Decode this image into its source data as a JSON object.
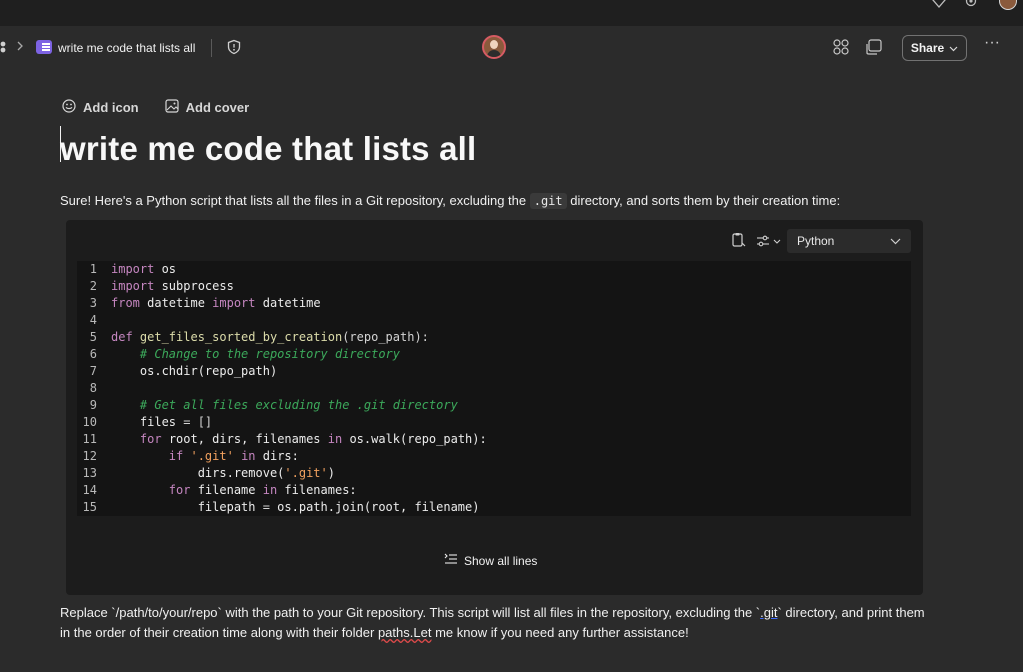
{
  "breadcrumb": {
    "page_title": "write me code that lists all"
  },
  "toolbar": {
    "share_label": "Share",
    "more_label": "···"
  },
  "page": {
    "add_icon_label": "Add icon",
    "add_cover_label": "Add cover",
    "title": "write me code that lists all",
    "intro_before": "Sure! Here's a Python script that lists all the files in a Git repository, excluding the ",
    "intro_code": ".git",
    "intro_after": " directory, and sorts them by their creation time:",
    "outro_before": "Replace `/path/to/your/repo` with the path to your Git repository. This script will list all files in the repository, excluding the `",
    "outro_u1": ".git",
    "outro_mid": "` directory, and print them in the order of their creation time along with their folder ",
    "outro_u2": "paths.Let",
    "outro_after": " me know if you need any further assistance!"
  },
  "code_block": {
    "language": "Python",
    "show_all_label": "Show all lines",
    "lines": [
      {
        "n": "1",
        "tokens": [
          {
            "t": "import",
            "c": "kw"
          },
          {
            "t": " os",
            "c": ""
          }
        ]
      },
      {
        "n": "2",
        "tokens": [
          {
            "t": "import",
            "c": "kw"
          },
          {
            "t": " subprocess",
            "c": ""
          }
        ]
      },
      {
        "n": "3",
        "tokens": [
          {
            "t": "from",
            "c": "kw"
          },
          {
            "t": " datetime ",
            "c": ""
          },
          {
            "t": "import",
            "c": "kw"
          },
          {
            "t": " datetime",
            "c": ""
          }
        ]
      },
      {
        "n": "4",
        "tokens": []
      },
      {
        "n": "5",
        "tokens": [
          {
            "t": "def",
            "c": "kw"
          },
          {
            "t": " get_files_sorted_by_creation",
            "c": "fn"
          },
          {
            "t": "(repo_path):",
            "c": "op"
          }
        ]
      },
      {
        "n": "6",
        "tokens": [
          {
            "t": "    ",
            "c": ""
          },
          {
            "t": "# Change to the repository directory",
            "c": "cm"
          }
        ]
      },
      {
        "n": "7",
        "tokens": [
          {
            "t": "    os.chdir(repo_path)",
            "c": ""
          }
        ]
      },
      {
        "n": "8",
        "tokens": []
      },
      {
        "n": "9",
        "tokens": [
          {
            "t": "    ",
            "c": ""
          },
          {
            "t": "# Get all files excluding the .git directory",
            "c": "cm"
          }
        ]
      },
      {
        "n": "10",
        "tokens": [
          {
            "t": "    files ",
            "c": ""
          },
          {
            "t": "= []",
            "c": "op"
          }
        ]
      },
      {
        "n": "11",
        "tokens": [
          {
            "t": "    ",
            "c": ""
          },
          {
            "t": "for",
            "c": "kw"
          },
          {
            "t": " root, dirs, filenames ",
            "c": ""
          },
          {
            "t": "in",
            "c": "kw"
          },
          {
            "t": " os.walk(repo_path):",
            "c": ""
          }
        ]
      },
      {
        "n": "12",
        "tokens": [
          {
            "t": "        ",
            "c": ""
          },
          {
            "t": "if",
            "c": "kw"
          },
          {
            "t": " ",
            "c": ""
          },
          {
            "t": "'.git'",
            "c": "st"
          },
          {
            "t": " ",
            "c": ""
          },
          {
            "t": "in",
            "c": "kw"
          },
          {
            "t": " dirs:",
            "c": ""
          }
        ]
      },
      {
        "n": "13",
        "tokens": [
          {
            "t": "            dirs.remove(",
            "c": ""
          },
          {
            "t": "'.git'",
            "c": "st"
          },
          {
            "t": ")",
            "c": ""
          }
        ]
      },
      {
        "n": "14",
        "tokens": [
          {
            "t": "        ",
            "c": ""
          },
          {
            "t": "for",
            "c": "kw"
          },
          {
            "t": " filename ",
            "c": ""
          },
          {
            "t": "in",
            "c": "kw"
          },
          {
            "t": " filenames:",
            "c": ""
          }
        ]
      },
      {
        "n": "15",
        "tokens": [
          {
            "t": "            filepath ",
            "c": ""
          },
          {
            "t": "=",
            "c": "op"
          },
          {
            "t": " os.path.join(root, filename)",
            "c": ""
          }
        ]
      }
    ]
  }
}
